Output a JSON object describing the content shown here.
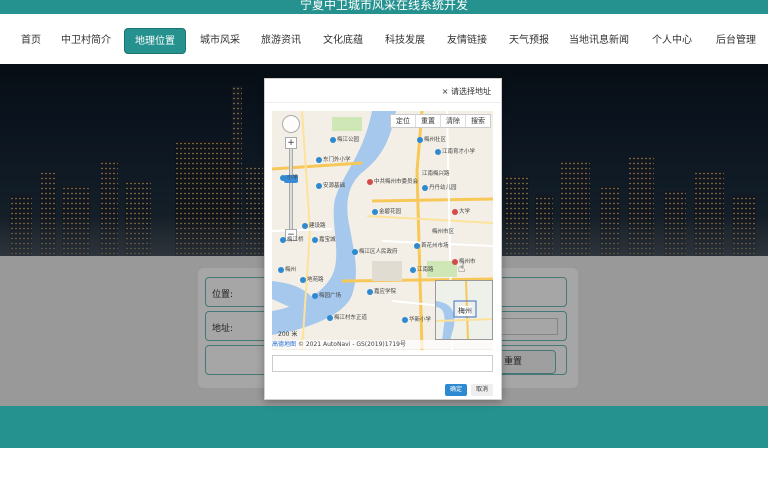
{
  "site": {
    "title": "宁夏中卫城市风采在线系统开发"
  },
  "nav": [
    {
      "label": "首页",
      "active": false
    },
    {
      "label": "中卫村简介",
      "active": false
    },
    {
      "label": "地理位置",
      "active": true
    },
    {
      "label": "城市风采",
      "active": false
    },
    {
      "label": "旅游资讯",
      "active": false
    },
    {
      "label": "文化底蕴",
      "active": false
    },
    {
      "label": "科技发展",
      "active": false
    },
    {
      "label": "友情链接",
      "active": false
    },
    {
      "label": "天气预报",
      "active": false
    },
    {
      "label": "当地讯息新闻",
      "active": false
    },
    {
      "label": "个人中心",
      "active": false
    },
    {
      "label": "后台管理",
      "active": false
    }
  ],
  "form": {
    "location_label": "位置:",
    "address_label": "地址:",
    "reset_label": "重置"
  },
  "dialog": {
    "close_label": "× 请选择地址",
    "tools": [
      "定位",
      "重置",
      "清除",
      "搜索"
    ],
    "scale": "200 米",
    "copyright_brand": "高德地图",
    "copyright": "© 2021 AutoNavi - GS(2019)1719号",
    "minimap_label": "梅州",
    "ok_label": "确定",
    "cancel_label": "取消",
    "pois": [
      "梅江公园",
      "梅州社区",
      "江南育才小学",
      "东门外小学",
      "小学",
      "中共梅州市委员会",
      "江南梅兴路",
      "丹丹幼儿园",
      "安源基础",
      "金碧花园",
      "大学",
      "建设路",
      "嘉宝城",
      "梅江桥",
      "梅州市区",
      "梅江区人民政府",
      "首花州市场",
      "江南路",
      "梅州市",
      "梅州",
      "地苑路",
      "梅园广场",
      "嘉应学院",
      "梅江村东正道",
      "华新小学"
    ]
  },
  "colors": {
    "primary": "#26928f",
    "active_border": "#1d7471"
  }
}
